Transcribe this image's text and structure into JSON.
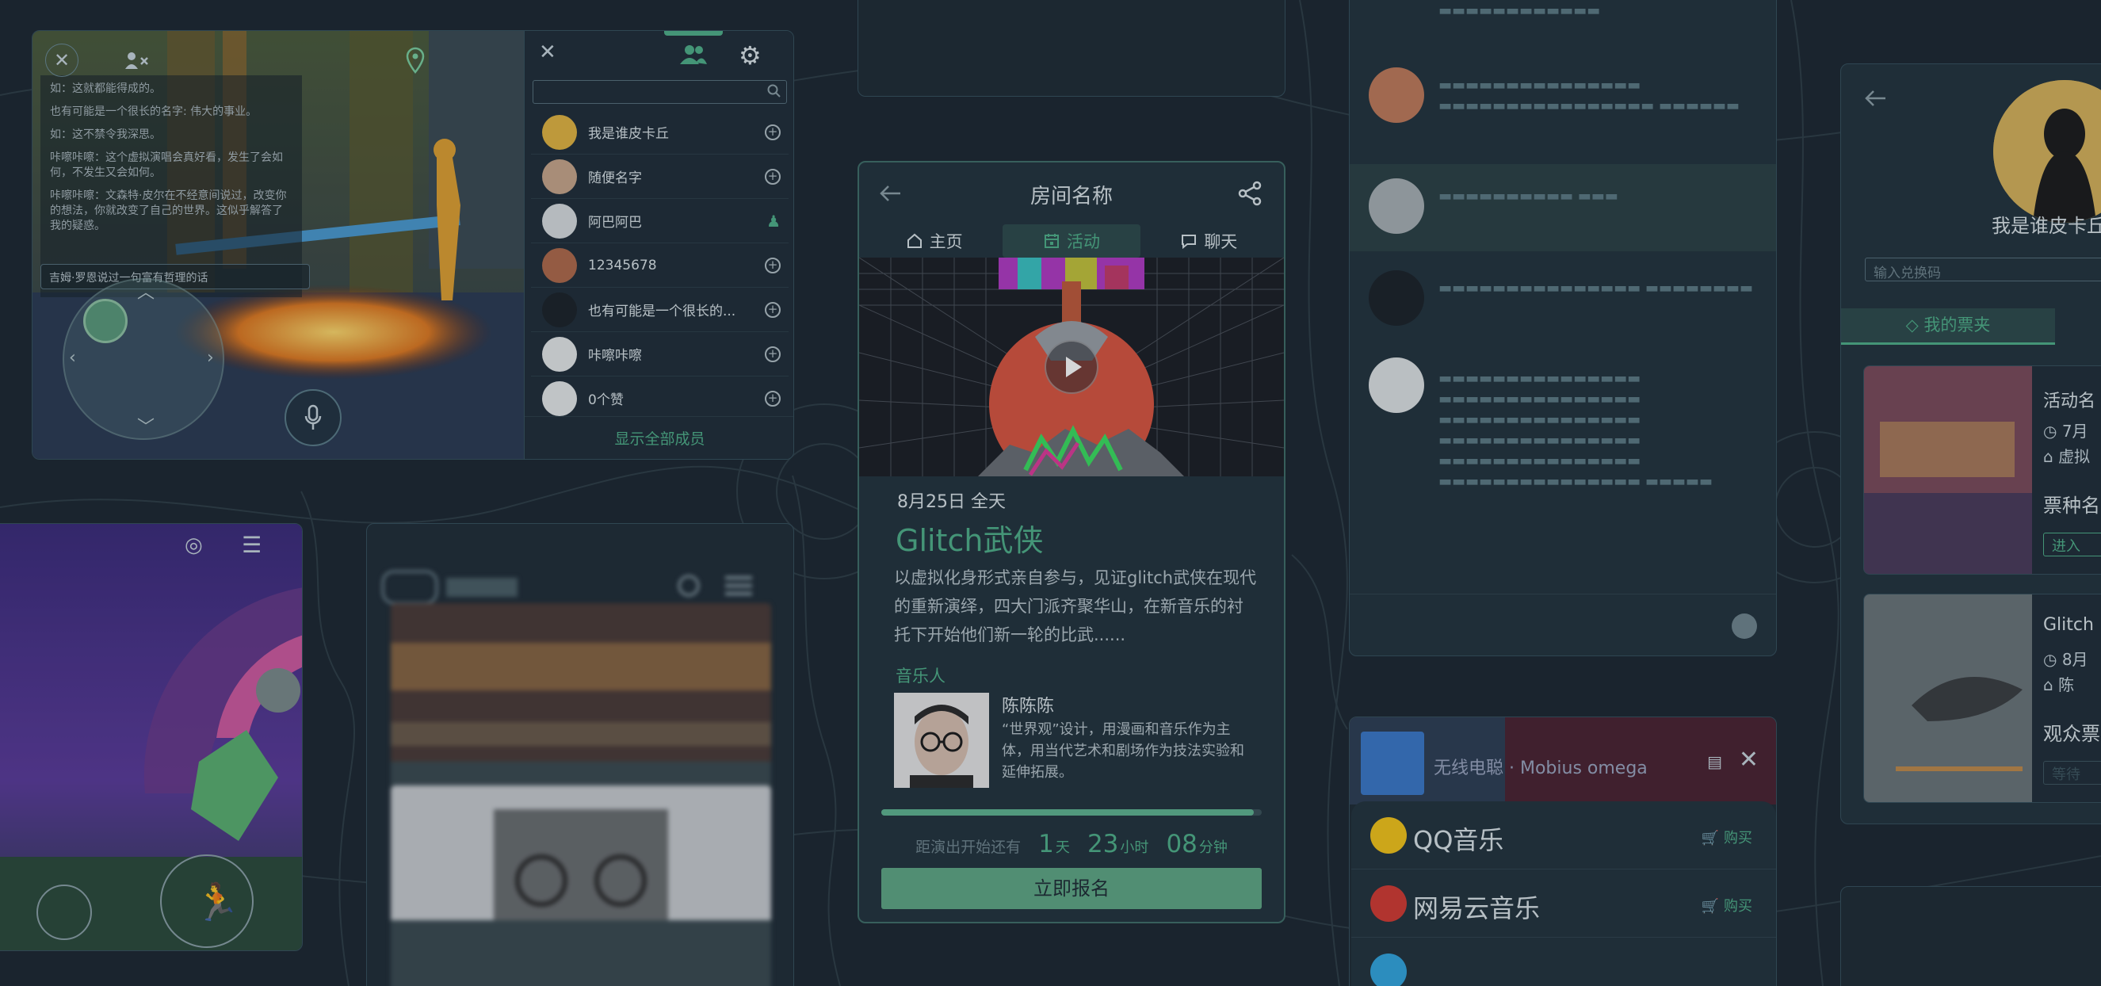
{
  "colors": {
    "background": "#1b2730",
    "accent_green": "#4fb089",
    "panel": "#22323c",
    "border": "#35505c"
  },
  "game_panel": {
    "chat_lines": [
      "如：这就都能得成的。",
      "也有可能是一个很长的名字: 伟大的事业。",
      "如：这不禁令我深思。",
      "咔嚓咔嚓：这个虚拟演唱会真好看，发生了会如何，不发生又会如何。",
      "咔嚓咔嚓：文森特·皮尔在不经意间说过，改变你的想法，你就改变了自己的世界。这似乎解答了我的疑惑。"
    ],
    "chat_input_value": "吉姆·罗恩说过一句富有哲理的话",
    "icons": [
      "close-icon",
      "kick-user-icon",
      "location-pin-icon",
      "microphone-icon"
    ],
    "members_panel": {
      "icons": [
        "close-icon",
        "members-icon",
        "gear-icon",
        "search-icon"
      ],
      "members": [
        {
          "name": "我是谁皮卡丘",
          "action": "add"
        },
        {
          "name": "随便名字",
          "action": "add"
        },
        {
          "name": "阿巴阿巴",
          "action": "friend"
        },
        {
          "name": "12345678",
          "action": "add"
        },
        {
          "name": "也有可能是一个很长的...",
          "action": "add"
        },
        {
          "name": "咔嚓咔嚓",
          "action": "add"
        },
        {
          "name": "0个赞",
          "action": "add"
        }
      ],
      "show_all_label": "显示全部成员"
    }
  },
  "event_panel": {
    "room_title": "房间名称",
    "tabs": [
      {
        "label": "主页",
        "icon": "home-icon",
        "active": false
      },
      {
        "label": "活动",
        "icon": "calendar-icon",
        "active": true
      },
      {
        "label": "聊天",
        "icon": "chat-bubble-icon",
        "active": false
      }
    ],
    "date": "8月25日 全天",
    "event_name": "Glitch武侠",
    "description": "以虚拟化身形式亲自参与，见证glitch武侠在现代的重新演绎，四大门派齐聚华山，在新音乐的衬托下开始他们新一轮的比武......",
    "musician_label": "音乐人",
    "musician_name": "陈陈陈",
    "musician_bio": "“世界观”设计，用漫画和音乐作为主体，用当代艺术和剧场作为技法实验和延伸拓展。",
    "progress": 0.98,
    "countdown_prefix": "距演出开始还有",
    "countdown": {
      "days": "1",
      "days_unit": "天",
      "hours": "23",
      "hours_unit": "小时",
      "minutes": "08",
      "minutes_unit": "分钟"
    },
    "signup_label": "立即报名"
  },
  "music_panel": {
    "now_playing": "无线电聪 · Mobius omega",
    "services": [
      {
        "name": "QQ音乐",
        "buy": "购买",
        "color": "#f5c518"
      },
      {
        "name": "网易云音乐",
        "buy": "购买",
        "color": "#d33a31"
      },
      {
        "name": "",
        "buy": "",
        "color": "#31a6e0"
      }
    ]
  },
  "profile_panel": {
    "username": "我是谁皮卡丘",
    "redeem_placeholder": "输入兑换码",
    "tickets_tab": "我的票夹",
    "cards": [
      {
        "name": "活动名",
        "date": "7月",
        "venue": "虚拟",
        "ticket_type": "票种名",
        "button": "进入"
      },
      {
        "name": "Glitch",
        "date": "8月",
        "venue": "陈",
        "ticket_type": "观众票",
        "button": "等待"
      }
    ]
  }
}
